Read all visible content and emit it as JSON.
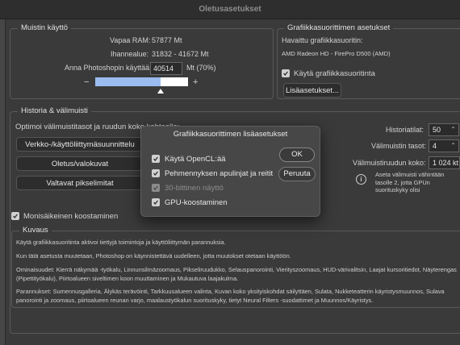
{
  "window": {
    "title": "Oletusasetukset"
  },
  "memory": {
    "title": "Muistin käyttö",
    "free_ram_label": "Vapaa RAM:",
    "free_ram_value": "57877 Mt",
    "ideal_label": "Ihannealue:",
    "ideal_value": "31832 - 41672 Mt",
    "allow_label": "Anna Photoshopin käyttää:",
    "allow_value": "40514",
    "allow_unit": "Mt (70%)",
    "minus": "−",
    "plus": "+",
    "slider_fraction": 0.7
  },
  "gpu_settings": {
    "title": "Grafiikkasuorittimen asetukset",
    "detected_label": "Havaittu grafiikkasuoritin:",
    "gpu_name": "AMD Radeon HD - FirePro D500 (AMD)",
    "use_gpu_label": "Käytä grafiikkasuoritinta",
    "advanced_button": "Lisäasetukset..."
  },
  "history": {
    "title": "Historia & välimuisti",
    "optimize_text": "Optimoi välimuistitasot ja ruudun koko kohteelle:",
    "opt_buttons": [
      "Verkko-/käyttöliittymäsuunnittelu",
      "Oletus/valokuvat",
      "Valtavat pikselimitat"
    ],
    "states_label": "Historiatilat:",
    "states_value": "50",
    "cache_levels_label": "Välimuistin tasot:",
    "cache_levels_value": "4",
    "tile_size_label": "Välimuistiruudun koko:",
    "tile_size_value": "1 024 kt",
    "info_text": "Aseta välimuisti vähintään tasolle 2, jotta GPUn suorituskyky olisi parhaimmillaan."
  },
  "multithread": {
    "label": "Monisäikeinen koostaminen"
  },
  "description": {
    "title": "Kuvaus",
    "p1": "Käytä grafiikkasuoritinta aktivoi tiettyjä toimintoja ja käyttöliittymän parannuksia.",
    "p2": "Kun tätä asetusta muutetaan, Photoshop on käynnistettävä uudelleen, jotta muutokset otetaan käyttöön.",
    "p3": "Ominaisuudet: Kierrä näkymää -työkalu, Linnunsilmäzoomaus, Pikseliruudukko, Selauspanorointi, Vierityszoomaus, HUD-värivalitsin, Laajat kursoritiedot, Näyterengas (Pipettityökalu), Piirtoalueen siveltimen koon muuttaminen ja Mukautuva laajakulma.",
    "p4": "Parannukset: Sumennusgalleria, Älykäs terävöinti, Tarkkuusalueen valinta, Kuvan koko yksityiskohdat säilyttäen, Sulata, Nukketeatterin käyristysmuunnos, Sulava panorointi ja zoomaus, piirtoalueen reunan varjo, maalaustyökalun suorituskyky, tietyt Neural Filters -suodattimet ja Muunnos/Käyristys."
  },
  "dialog": {
    "title": "Grafiikkasuorittimen lisäasetukset",
    "options": [
      {
        "label": "Käytä OpenCL:ää",
        "checked": true,
        "enabled": true
      },
      {
        "label": "Pehmennyksen apulinjat ja reitit",
        "checked": true,
        "enabled": true
      },
      {
        "label": "30-bittinen näyttö",
        "checked": true,
        "enabled": false
      },
      {
        "label": "GPU-koostaminen",
        "checked": true,
        "enabled": true
      }
    ],
    "ok_label": "OK",
    "cancel_label": "Peruuta"
  },
  "colors": {
    "accent_blue": "#9bbcf0",
    "background": "#3a3a3a",
    "dialog_bg": "#474747"
  }
}
